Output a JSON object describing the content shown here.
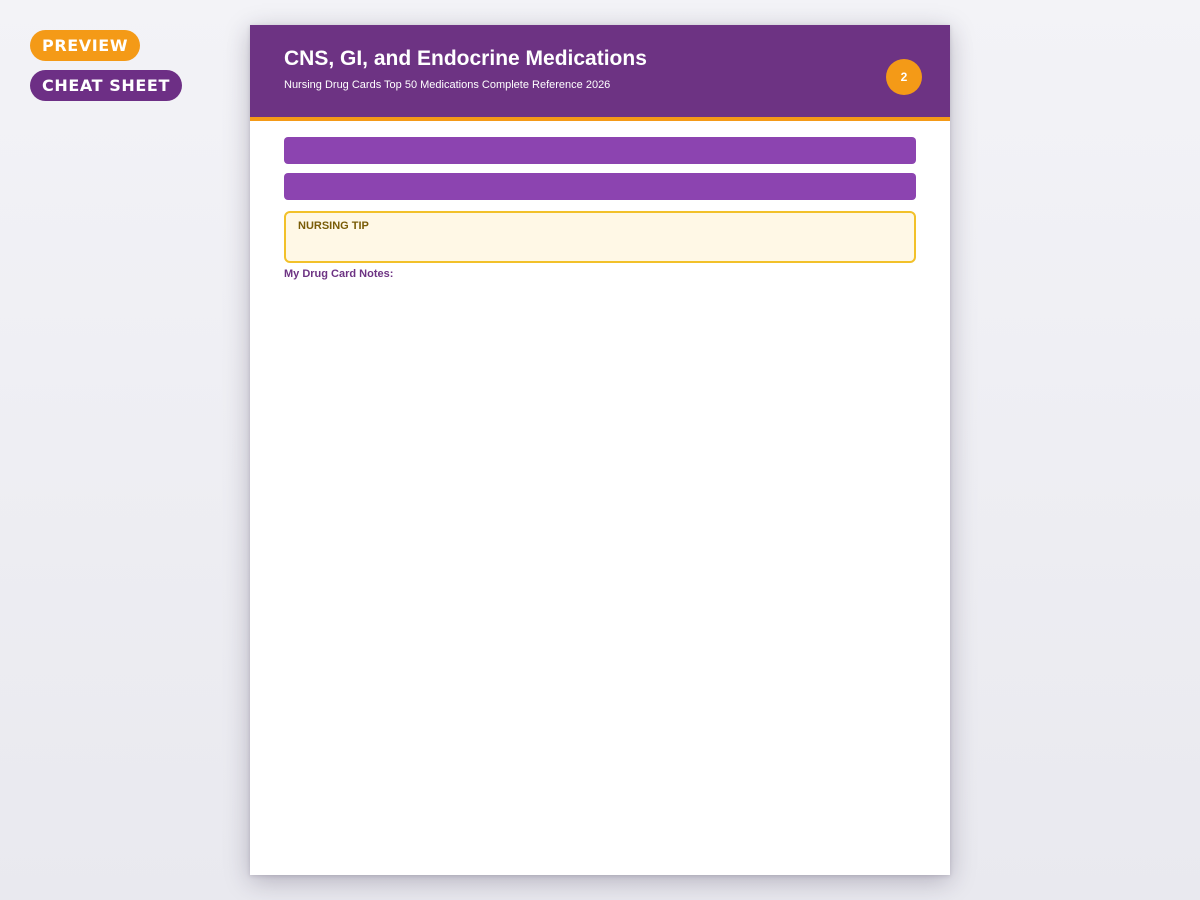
{
  "badges": {
    "preview": "PREVIEW",
    "cheat_sheet": "CHEAT SHEET"
  },
  "header": {
    "title": "CNS, GI, and Endocrine Medications",
    "subtitle": "Nursing Drug Cards Top 50 Medications Complete Reference 2026",
    "page_number": "2"
  },
  "tip": {
    "label": "NURSING TIP"
  },
  "notes": {
    "label": "My Drug Card Notes:"
  },
  "colors": {
    "primary": "#6d3383",
    "accent": "#f49a17",
    "section_bar": "#8c44b0",
    "tip_border": "#f2c12a",
    "tip_background": "#fff8e6"
  }
}
